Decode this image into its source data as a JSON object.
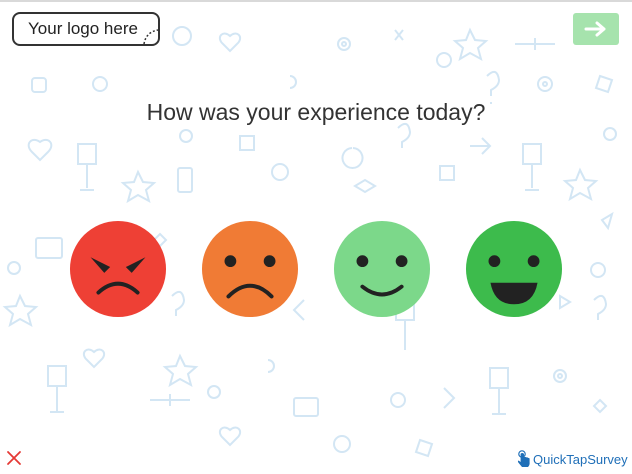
{
  "logo": {
    "text": "Your logo here"
  },
  "next_button": {
    "icon": "arrow-right-icon",
    "color": "#a6e3ad"
  },
  "question": {
    "text": "How was your experience today?"
  },
  "faces": [
    {
      "rating": "very-dissatisfied",
      "color": "#ee4035",
      "icon": "angry-face-icon"
    },
    {
      "rating": "dissatisfied",
      "color": "#f07b35",
      "icon": "sad-face-icon"
    },
    {
      "rating": "satisfied",
      "color": "#7cd88a",
      "icon": "smile-face-icon"
    },
    {
      "rating": "very-satisfied",
      "color": "#3dbb4c",
      "icon": "grin-face-icon"
    }
  ],
  "footer": {
    "close_icon": "close-icon",
    "close_color": "#e53935",
    "brand_text": "QuickTapSurvey",
    "brand_color": "#1f6fb8"
  }
}
